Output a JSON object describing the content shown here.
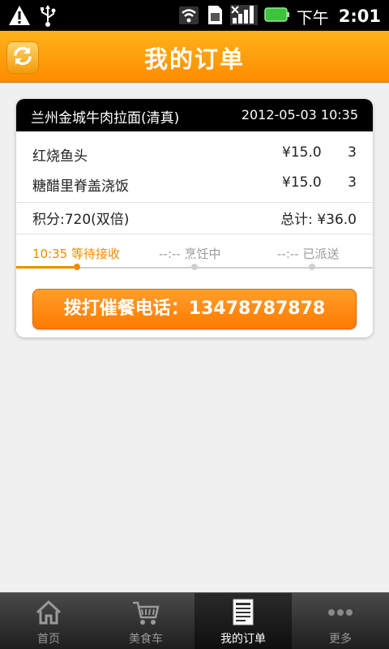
{
  "status_bar": {
    "icons": [
      "warning-icon",
      "usb-icon",
      "wifi-icon",
      "sim-icon",
      "signal-icon",
      "battery-icon"
    ],
    "ampm": "下午",
    "time": "2:01"
  },
  "header": {
    "title": "我的订单",
    "refresh_icon": "refresh-icon"
  },
  "order": {
    "shop_name": "兰州金城牛肉拉面(清真)",
    "datetime": "2012-05-03 10:35",
    "items": [
      {
        "name": "红烧鱼头",
        "price": "¥15.0",
        "qty": "3"
      },
      {
        "name": "糖醋里脊盖浇饭",
        "price": "¥15.0",
        "qty": "3"
      }
    ],
    "points": "积分:720(双倍)",
    "total": "总计: ¥36.0",
    "steps": [
      {
        "text": "10:35 等待接收",
        "active": true
      },
      {
        "text": "--:-- 烹饪中",
        "active": false
      },
      {
        "text": "--:-- 已派送",
        "active": false
      }
    ],
    "progress_fraction": 0.17,
    "call_button": "拨打催餐电话：13478787878"
  },
  "tabs": [
    {
      "label": "首页",
      "icon": "home-icon",
      "active": false
    },
    {
      "label": "美食车",
      "icon": "cart-icon",
      "active": false
    },
    {
      "label": "我的订单",
      "icon": "order-list-icon",
      "active": true
    },
    {
      "label": "更多",
      "icon": "more-icon",
      "active": false
    }
  ],
  "colors": {
    "accent": "#ff8c00",
    "progress": "#f08c00"
  }
}
